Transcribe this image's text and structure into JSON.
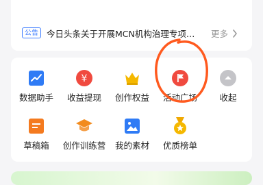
{
  "notice": {
    "badge": "公告",
    "text": "今日头条关于开展MCN机构治理专项…",
    "more": "更多"
  },
  "tools": [
    {
      "label": "数据助手",
      "icon": "chart-icon",
      "color": "#2f7bf5"
    },
    {
      "label": "收益提现",
      "icon": "yen-icon",
      "color": "#f04a3f"
    },
    {
      "label": "创作权益",
      "icon": "crown-icon",
      "color": "#f5b800"
    },
    {
      "label": "活动广场",
      "icon": "flag-icon",
      "color": "#f04a3f"
    },
    {
      "label": "收起",
      "icon": "collapse-up-icon",
      "color": "#c4c4c8"
    },
    {
      "label": "草稿箱",
      "icon": "draft-icon",
      "color": "#f47a1f"
    },
    {
      "label": "创作训练营",
      "icon": "graduation-cap-icon",
      "color": "#f28b1e"
    },
    {
      "label": "我的素材",
      "icon": "image-icon",
      "color": "#2f7bf5"
    },
    {
      "label": "优质榜单",
      "icon": "medal-icon",
      "color": "#f5b800"
    }
  ],
  "annotation": {
    "color": "#ff5a1f"
  }
}
